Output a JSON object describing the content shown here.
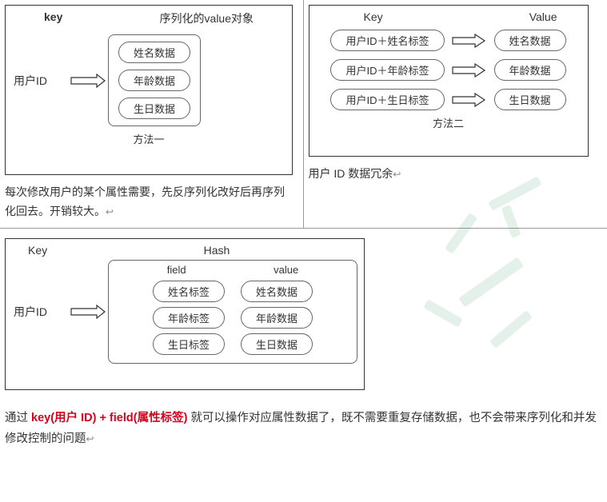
{
  "diag1": {
    "key_header": "key",
    "value_header": "序列化的value对象",
    "userid": "用户ID",
    "items": [
      "姓名数据",
      "年龄数据",
      "生日数据"
    ],
    "caption": "方法一",
    "desc_a": "每次修改用户的某个属性需要，先反序列化改好后再序列化回去。开销较大。",
    "ret": "↩"
  },
  "diag2": {
    "key_header": "Key",
    "value_header": "Value",
    "rows": [
      {
        "k": "用户ID＋姓名标签",
        "v": "姓名数据"
      },
      {
        "k": "用户ID＋年龄标签",
        "v": "年龄数据"
      },
      {
        "k": "用户ID＋生日标签",
        "v": "生日数据"
      }
    ],
    "caption": "方法二",
    "desc": "用户 ID 数据冗余",
    "ret": "↩"
  },
  "diag3": {
    "key_header": "Key",
    "hash_header": "Hash",
    "field_header": "field",
    "value_header": "value",
    "userid": "用户ID",
    "rows": [
      {
        "f": "姓名标签",
        "v": "姓名数据"
      },
      {
        "f": "年龄标签",
        "v": "年龄数据"
      },
      {
        "f": "生日标签",
        "v": "生日数据"
      }
    ]
  },
  "summary": {
    "pre": "通过 ",
    "red": "key(用户 ID) + field(属性标签) ",
    "post": "就可以操作对应属性数据了，既不需要重复存储数据，也不会带来序列化和并发修改控制的问题",
    "ret": "↩"
  },
  "chart_data": {
    "type": "table",
    "title": "Redis 数据结构方案对比：序列化对象 / 多键 / Hash",
    "methods": [
      {
        "name": "方法一",
        "key": "用户ID",
        "value_desc": "序列化的value对象",
        "values": [
          "姓名数据",
          "年龄数据",
          "生日数据"
        ],
        "drawback": "每次修改用户的某个属性需要，先反序列化改好后再序列化回去。开销较大。"
      },
      {
        "name": "方法二",
        "rows": [
          {
            "key": "用户ID＋姓名标签",
            "value": "姓名数据"
          },
          {
            "key": "用户ID＋年龄标签",
            "value": "年龄数据"
          },
          {
            "key": "用户ID＋生日标签",
            "value": "生日数据"
          }
        ],
        "drawback": "用户 ID 数据冗余"
      },
      {
        "name": "Hash",
        "key": "用户ID",
        "hash": [
          {
            "field": "姓名标签",
            "value": "姓名数据"
          },
          {
            "field": "年龄标签",
            "value": "年龄数据"
          },
          {
            "field": "生日标签",
            "value": "生日数据"
          }
        ],
        "advantage": "通过 key(用户 ID) + field(属性标签) 就可以操作对应属性数据了，既不需要重复存储数据，也不会带来序列化和并发修改控制的问题"
      }
    ]
  }
}
